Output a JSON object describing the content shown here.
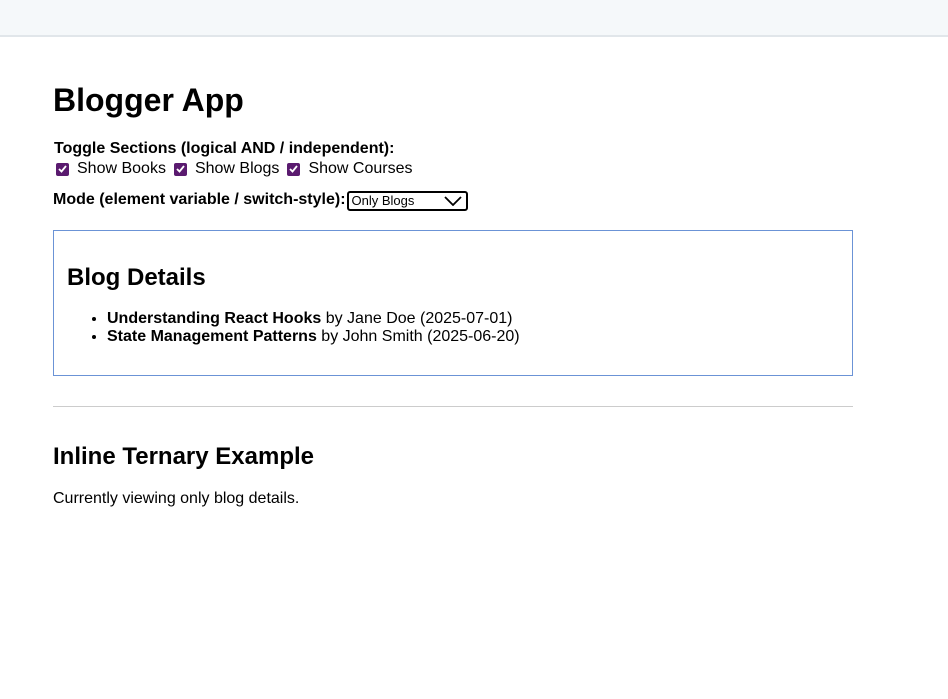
{
  "app": {
    "title": "Blogger App"
  },
  "toggles": {
    "label": "Toggle Sections (logical AND / independent):",
    "items": [
      {
        "label": "Show Books",
        "checked": true
      },
      {
        "label": "Show Blogs",
        "checked": true
      },
      {
        "label": "Show Courses",
        "checked": true
      }
    ]
  },
  "mode": {
    "label": "Mode (element variable / switch-style):",
    "selected": "Only Blogs"
  },
  "blog_details": {
    "heading": "Blog Details",
    "posts": [
      {
        "title": "Understanding React Hooks",
        "byline": " by Jane Doe (2025-07-01)"
      },
      {
        "title": "State Management Patterns",
        "byline": " by John Smith (2025-06-20)"
      }
    ]
  },
  "ternary": {
    "heading": "Inline Ternary Example",
    "text": "Currently viewing only blog details."
  },
  "colors": {
    "checkbox": "#5a1a6f",
    "box_border": "#6b93d6",
    "topbar": "#f5f8fa"
  }
}
